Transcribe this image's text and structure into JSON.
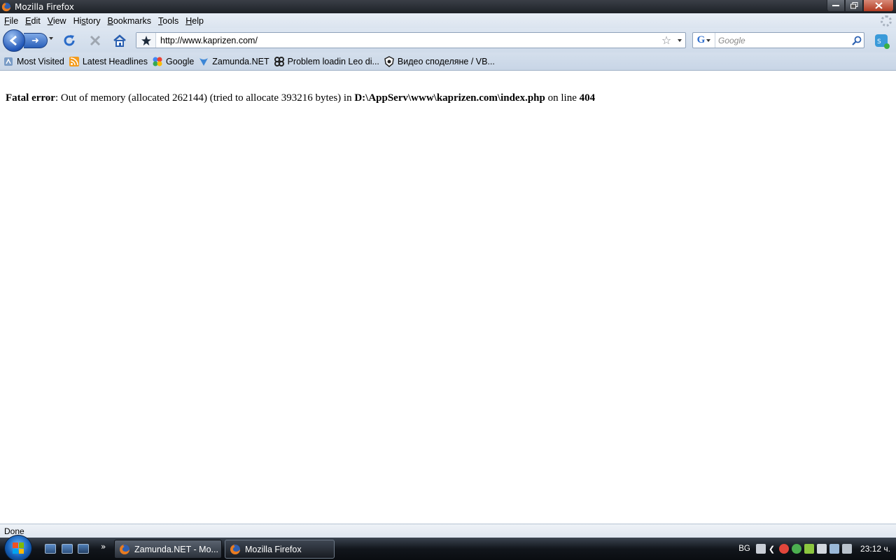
{
  "window": {
    "title": "Mozilla Firefox"
  },
  "menu": [
    {
      "key": "F",
      "rest": "ile"
    },
    {
      "key": "E",
      "rest": "dit"
    },
    {
      "key": "V",
      "rest": "iew"
    },
    {
      "key": "s",
      "pre": "Hi",
      "rest": "tory"
    },
    {
      "key": "B",
      "rest": "ookmarks"
    },
    {
      "key": "T",
      "rest": "ools"
    },
    {
      "key": "H",
      "rest": "elp"
    }
  ],
  "nav": {
    "url": "http://www.kaprizen.com/",
    "search_placeholder": "Google"
  },
  "bookmarks": [
    {
      "label": "Most Visited",
      "icon": "most-visited-icon"
    },
    {
      "label": "Latest Headlines",
      "icon": "rss-icon"
    },
    {
      "label": "Google",
      "icon": "google-icon"
    },
    {
      "label": "Zamunda.NET",
      "icon": "zamunda-icon"
    },
    {
      "label": "Problem loadin Leo di...",
      "icon": "leo-icon"
    },
    {
      "label": "Видео споделяне / VB...",
      "icon": "vbox-icon"
    }
  ],
  "page": {
    "error_label": "Fatal error",
    "error_message": ": Out of memory (allocated 262144) (tried to allocate 393216 bytes) in ",
    "error_path": "D:\\AppServ\\www\\kaprizen.com\\index.php",
    "error_online": " on line ",
    "error_line": "404"
  },
  "status": {
    "text": "Done"
  },
  "taskbar": {
    "tasks": [
      {
        "label": "Zamunda.NET - Mo...",
        "active": false
      },
      {
        "label": "Mozilla Firefox",
        "active": true
      }
    ],
    "lang": "BG",
    "clock": "23:12 ч."
  },
  "colors": {
    "accent": "#2257b8",
    "titlebar": "#1d2127",
    "toolbar": "#dde6f1"
  }
}
